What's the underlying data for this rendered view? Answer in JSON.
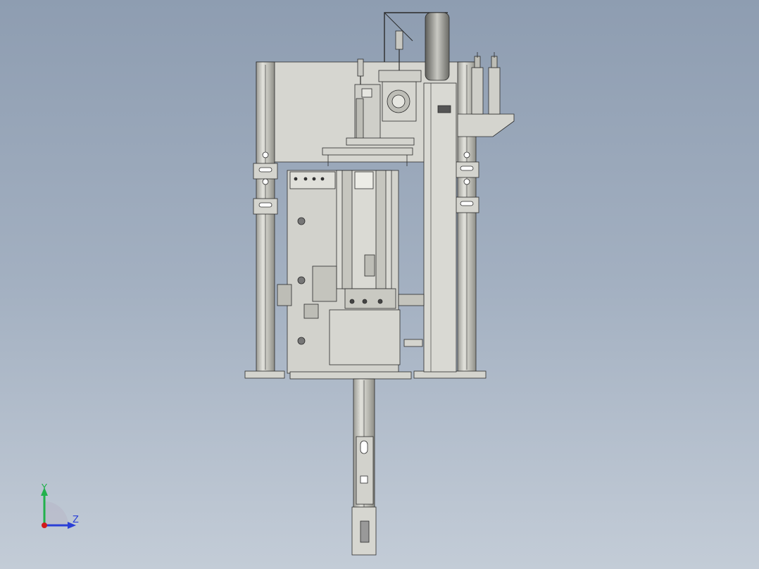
{
  "viewport": {
    "background_top": "#8e9db1",
    "background_bottom": "#c3ccd7",
    "part_fill": "#cfcfc9",
    "part_fill_dark": "#b4b4ac",
    "edge_color": "#2b2b2b"
  },
  "triad": {
    "y_label": "Y",
    "z_label": "Z",
    "y_color": "#22b14c",
    "z_color": "#2a3fd6",
    "x_color": "#d11a1a"
  }
}
